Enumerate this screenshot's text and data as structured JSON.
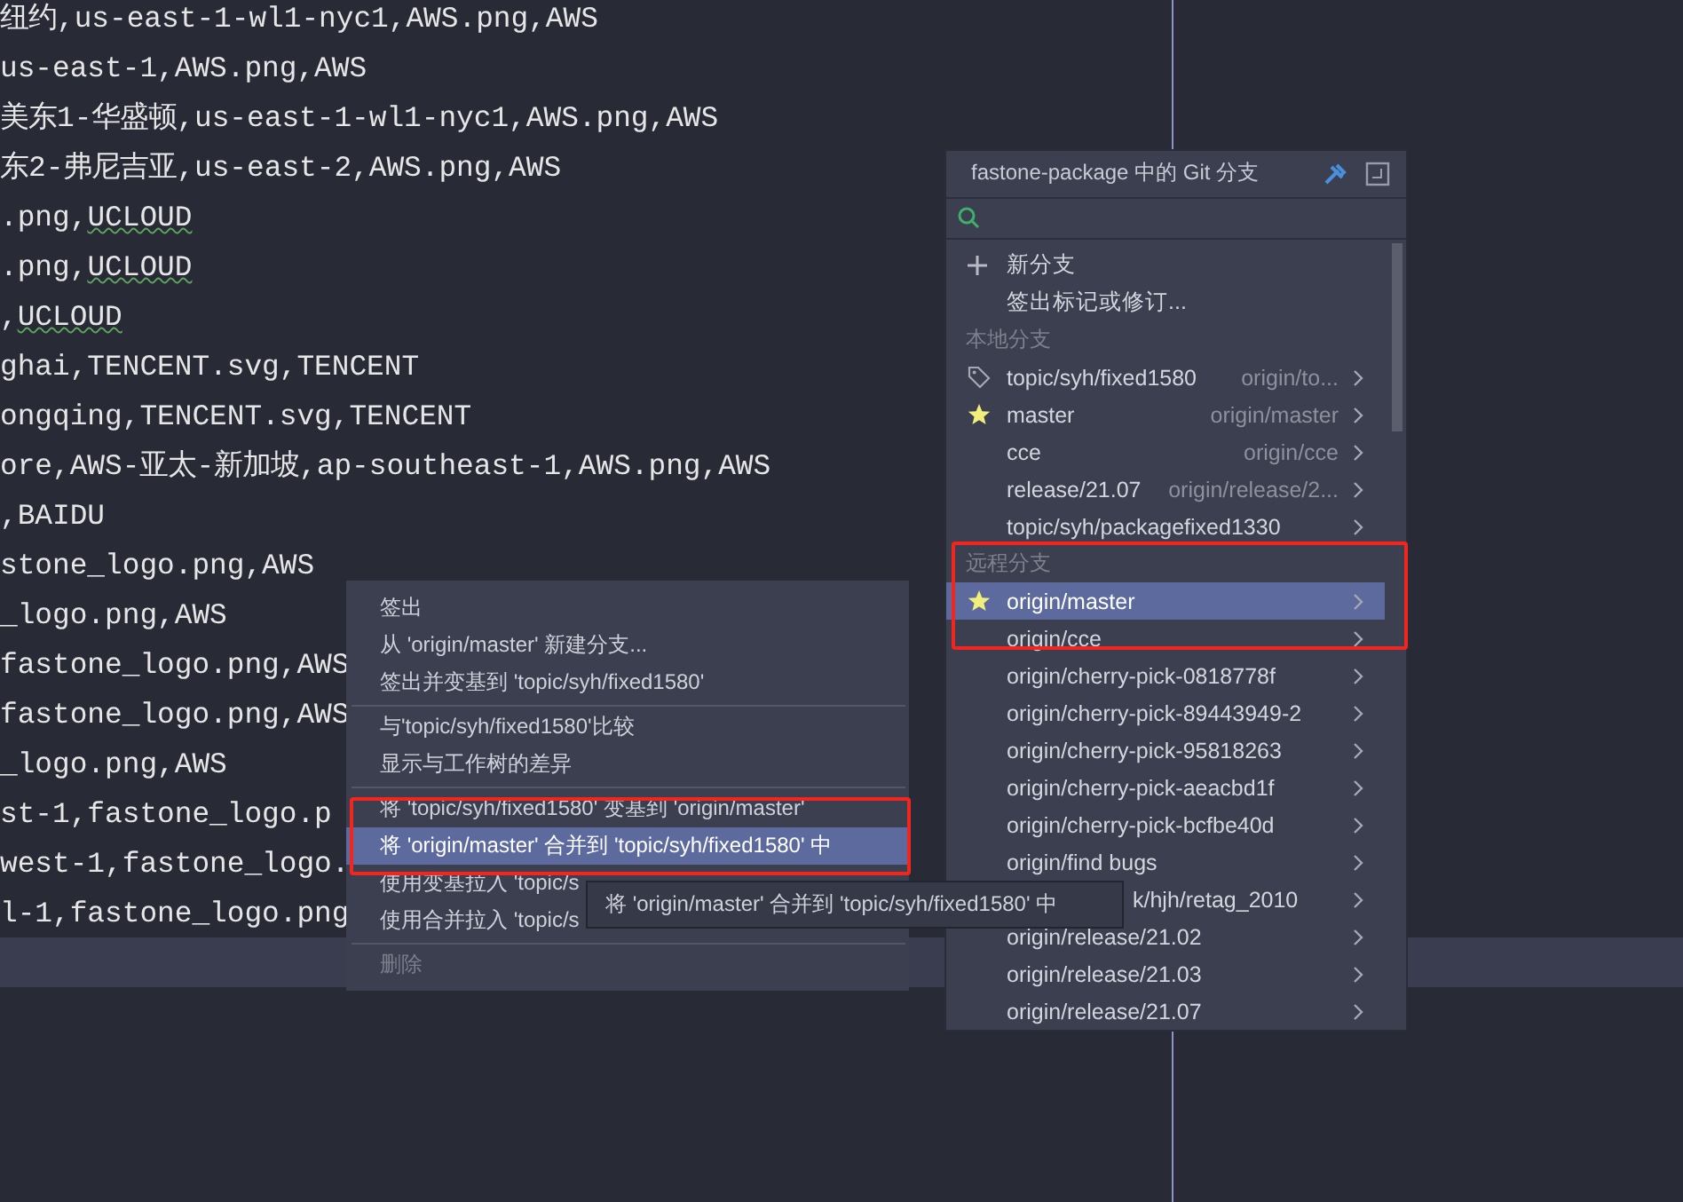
{
  "editor": {
    "lines": [
      {
        "text": "纽约,us-east-1-wl1-nyc1,AWS.png,AWS"
      },
      {
        "text": "us-east-1,AWS.png,AWS"
      },
      {
        "text": "美东1-华盛顿,us-east-1-wl1-nyc1,AWS.png,AWS"
      },
      {
        "text": "东2-弗尼吉亚,us-east-2,AWS.png,AWS"
      },
      {
        "text": ".png,",
        "flagged": "UCLOUD"
      },
      {
        "text": ".png,",
        "flagged": "UCLOUD"
      },
      {
        "text": ",",
        "flagged": "UCLOUD"
      },
      {
        "text": "ghai,TENCENT.svg,TENCENT"
      },
      {
        "text": "ongqing,TENCENT.svg,TENCENT"
      },
      {
        "text": "ore,AWS-亚太-新加坡,ap-southeast-1,AWS.png,AWS"
      },
      {
        "text": ",BAIDU"
      },
      {
        "text": "stone_logo.png,AWS"
      },
      {
        "text": "_logo.png,AWS"
      },
      {
        "text": "fastone_logo.png,AWS"
      },
      {
        "text": "fastone_logo.png,AWS"
      },
      {
        "text": "_logo.png,AWS"
      },
      {
        "text": "st-1,fastone_logo.p"
      },
      {
        "text": "west-1,fastone_logo."
      },
      {
        "text": "l-1,fastone_logo.png"
      }
    ]
  },
  "context_menu": {
    "groups": [
      [
        {
          "label": "签出",
          "selected": false,
          "disabled": false
        },
        {
          "label": "从 'origin/master' 新建分支...",
          "selected": false,
          "disabled": false
        },
        {
          "label": "签出并变基到 'topic/syh/fixed1580'",
          "selected": false,
          "disabled": false
        }
      ],
      [
        {
          "label": "与'topic/syh/fixed1580'比较",
          "selected": false,
          "disabled": false
        },
        {
          "label": "显示与工作树的差异",
          "selected": false,
          "disabled": false
        }
      ],
      [
        {
          "label": "将 'topic/syh/fixed1580' 变基到 'origin/master'",
          "selected": false,
          "disabled": false
        },
        {
          "label": "将 'origin/master' 合并到 'topic/syh/fixed1580' 中",
          "selected": true,
          "disabled": false
        },
        {
          "label": "使用变基拉入 'topic/s",
          "selected": false,
          "disabled": false
        },
        {
          "label": "使用合并拉入 'topic/s",
          "selected": false,
          "disabled": false
        }
      ],
      [
        {
          "label": "删除",
          "selected": false,
          "disabled": true
        }
      ]
    ]
  },
  "tooltip": {
    "text": "将 'origin/master' 合并到 'topic/syh/fixed1580' 中"
  },
  "branch_popup": {
    "title": "fastone-package 中的 Git 分支",
    "items": [
      {
        "kind": "new",
        "label": "新分支"
      },
      {
        "kind": "action",
        "label": "签出标记或修订..."
      },
      {
        "kind": "header",
        "label": "本地分支"
      },
      {
        "kind": "tagged",
        "label": "topic/syh/fixed1580",
        "tracking": "origin/to...",
        "selected": false
      },
      {
        "kind": "starred",
        "label": "master",
        "tracking": "origin/master",
        "selected": false
      },
      {
        "kind": "branch",
        "label": "cce",
        "tracking": "origin/cce",
        "selected": false
      },
      {
        "kind": "branch",
        "label": "release/21.07",
        "tracking": "origin/release/2...",
        "selected": false
      },
      {
        "kind": "branch",
        "label": "topic/syh/packagefixed1330",
        "selected": false
      },
      {
        "kind": "header",
        "label": "远程分支"
      },
      {
        "kind": "starred",
        "label": "origin/master",
        "selected": true
      },
      {
        "kind": "branch",
        "label": "origin/cce",
        "selected": false
      },
      {
        "kind": "branch",
        "label": "origin/cherry-pick-0818778f",
        "selected": false
      },
      {
        "kind": "branch",
        "label": "origin/cherry-pick-89443949-2",
        "selected": false
      },
      {
        "kind": "branch",
        "label": "origin/cherry-pick-95818263",
        "selected": false
      },
      {
        "kind": "branch",
        "label": "origin/cherry-pick-aeacbd1f",
        "selected": false
      },
      {
        "kind": "branch",
        "label": "origin/cherry-pick-bcfbe40d",
        "selected": false
      },
      {
        "kind": "branch",
        "label": "origin/find bugs",
        "selected": false
      },
      {
        "kind": "covered",
        "label": "k/hjh/retag_2010",
        "selected": false
      },
      {
        "kind": "branch",
        "label": "origin/release/21.02",
        "selected": false
      },
      {
        "kind": "branch",
        "label": "origin/release/21.03",
        "selected": false
      },
      {
        "kind": "branch",
        "label": "origin/release/21.07",
        "selected": false
      }
    ]
  }
}
